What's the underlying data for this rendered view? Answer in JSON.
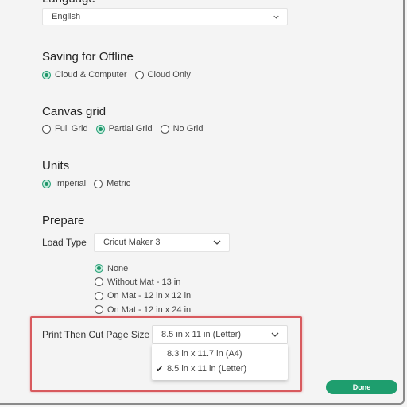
{
  "language": {
    "heading": "Language",
    "selected": "English"
  },
  "saving_offline": {
    "title": "Saving for Offline",
    "options": [
      {
        "label": "Cloud & Computer",
        "checked": true
      },
      {
        "label": "Cloud Only",
        "checked": false
      }
    ]
  },
  "canvas_grid": {
    "title": "Canvas grid",
    "options": [
      {
        "label": "Full Grid",
        "checked": false
      },
      {
        "label": "Partial Grid",
        "checked": true
      },
      {
        "label": "No Grid",
        "checked": false
      }
    ]
  },
  "units": {
    "title": "Units",
    "options": [
      {
        "label": "Imperial",
        "checked": true
      },
      {
        "label": "Metric",
        "checked": false
      }
    ]
  },
  "prepare": {
    "title": "Prepare",
    "load_type_label": "Load Type",
    "load_type_value": "Cricut Maker 3",
    "mat_options": [
      {
        "label": "None",
        "checked": true
      },
      {
        "label": "Without Mat - 13 in",
        "checked": false
      },
      {
        "label": "On Mat - 12 in x 12 in",
        "checked": false
      },
      {
        "label": "On Mat - 12 in x 24 in",
        "checked": false
      }
    ]
  },
  "print_then_cut": {
    "label": "Print Then Cut Page Size",
    "selected": "8.5 in x 11 in (Letter)",
    "options": [
      {
        "label": "8.3 in x 11.7 in (A4)",
        "checked": false
      },
      {
        "label": "8.5 in x 11 in (Letter)",
        "checked": true
      }
    ],
    "check_glyph": "✔"
  },
  "footer": {
    "done_label": "Done"
  },
  "colors": {
    "accent": "#1e9e6e",
    "highlight": "#d85a5e"
  }
}
